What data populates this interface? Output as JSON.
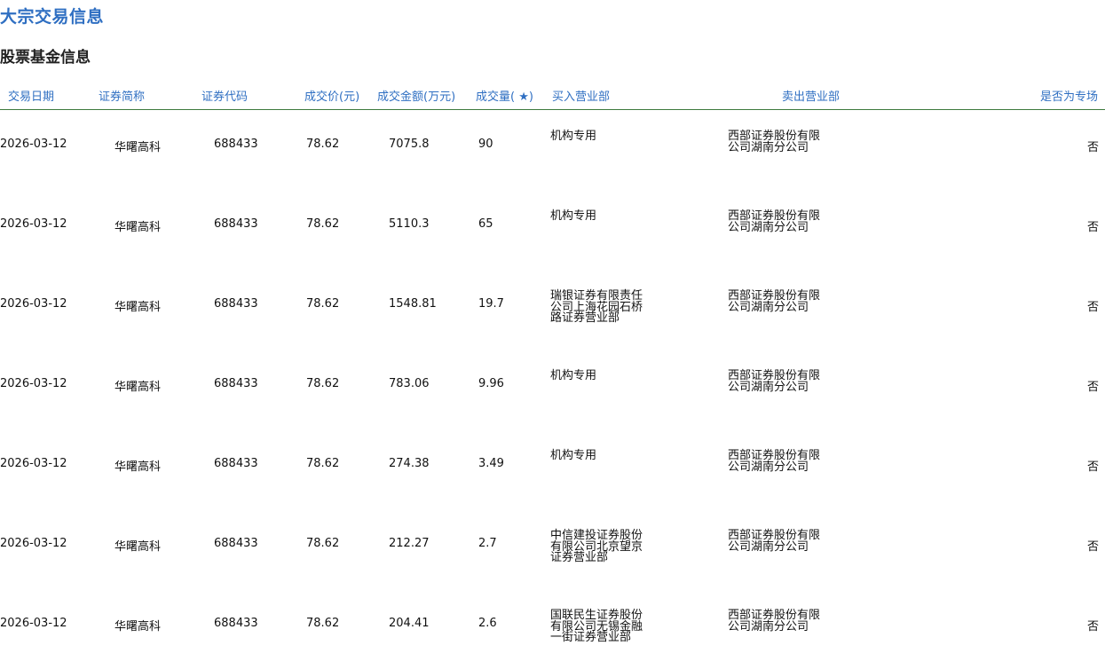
{
  "page_title": "大宗交易信息",
  "section_title": "股票基金信息",
  "table": {
    "headers": [
      "交易日期",
      "证券简称",
      "证券代码",
      "成交价(元)",
      "成交金额(万元)",
      "成交量( ★)",
      "买入营业部",
      "卖出营业部",
      "是否为专场"
    ],
    "rows": [
      {
        "date": "2026-03-12",
        "name": "华曙高科",
        "code": "688433",
        "price": "78.62",
        "amount": "7075.8",
        "volume": "90",
        "buyer": "机构专用",
        "seller": "西部证券股份有限\n公司湖南分公司",
        "special": "否"
      },
      {
        "date": "2026-03-12",
        "name": "华曙高科",
        "code": "688433",
        "price": "78.62",
        "amount": "5110.3",
        "volume": "65",
        "buyer": "机构专用",
        "seller": "西部证券股份有限\n公司湖南分公司",
        "special": "否"
      },
      {
        "date": "2026-03-12",
        "name": "华曙高科",
        "code": "688433",
        "price": "78.62",
        "amount": "1548.81",
        "volume": "19.7",
        "buyer": "瑞银证券有限责任\n公司上海花园石桥\n路证券营业部",
        "seller": "西部证券股份有限\n公司湖南分公司",
        "special": "否"
      },
      {
        "date": "2026-03-12",
        "name": "华曙高科",
        "code": "688433",
        "price": "78.62",
        "amount": "783.06",
        "volume": "9.96",
        "buyer": "机构专用",
        "seller": "西部证券股份有限\n公司湖南分公司",
        "special": "否"
      },
      {
        "date": "2026-03-12",
        "name": "华曙高科",
        "code": "688433",
        "price": "78.62",
        "amount": "274.38",
        "volume": "3.49",
        "buyer": "机构专用",
        "seller": "西部证券股份有限\n公司湖南分公司",
        "special": "否"
      },
      {
        "date": "2026-03-12",
        "name": "华曙高科",
        "code": "688433",
        "price": "78.62",
        "amount": "212.27",
        "volume": "2.7",
        "buyer": "中信建投证券股份\n有限公司北京望京\n证券营业部",
        "seller": "西部证券股份有限\n公司湖南分公司",
        "special": "否"
      },
      {
        "date": "2026-03-12",
        "name": "华曙高科",
        "code": "688433",
        "price": "78.62",
        "amount": "204.41",
        "volume": "2.6",
        "buyer": "国联民生证券股份\n有限公司无锡金融\n一街证券营业部",
        "seller": "西部证券股份有限\n公司湖南分公司",
        "special": "否"
      }
    ]
  }
}
